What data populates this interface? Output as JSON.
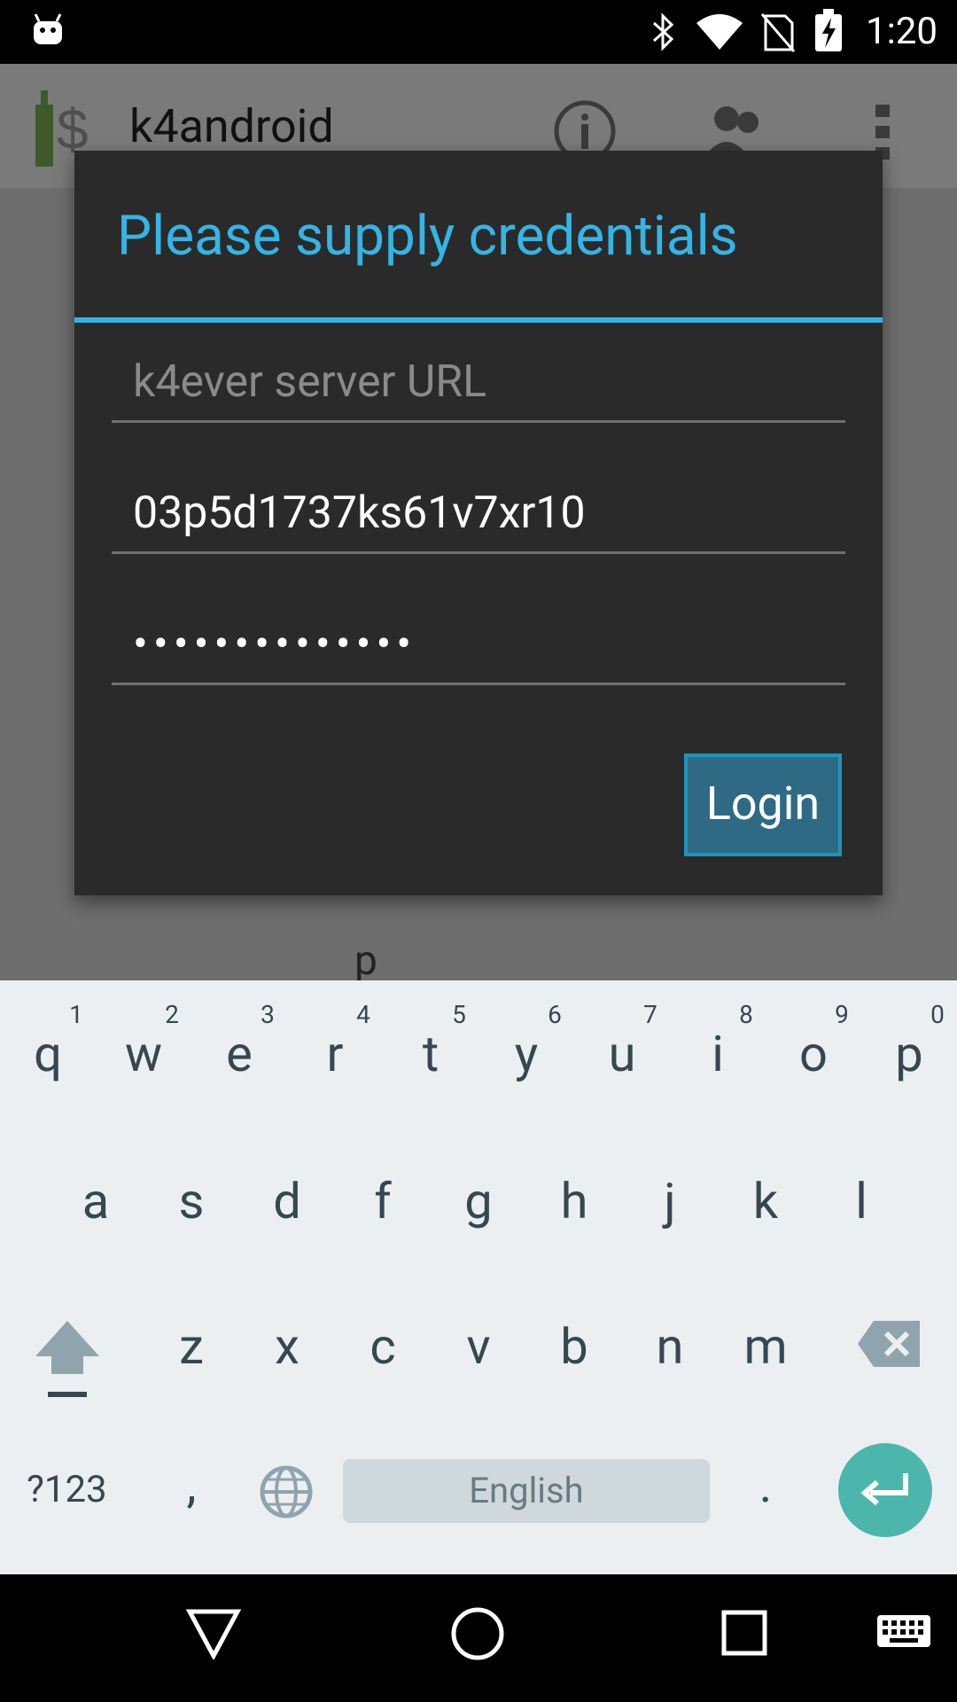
{
  "status_bar": {
    "time": "1:20"
  },
  "app": {
    "title": "k4android",
    "behind_text": "p"
  },
  "dialog": {
    "title": "Please supply credentials",
    "fields": [
      {
        "value": "",
        "placeholder": "k4ever server URL"
      },
      {
        "value": "03p5d1737ks61v7xr10",
        "placeholder": ""
      },
      {
        "value": "••••••••••••••",
        "placeholder": ""
      }
    ],
    "login_label": "Login"
  },
  "keyboard": {
    "row1": [
      "q",
      "w",
      "e",
      "r",
      "t",
      "y",
      "u",
      "i",
      "o",
      "p"
    ],
    "row1_hints": [
      "1",
      "2",
      "3",
      "4",
      "5",
      "6",
      "7",
      "8",
      "9",
      "0"
    ],
    "row2": [
      "a",
      "s",
      "d",
      "f",
      "g",
      "h",
      "j",
      "k",
      "l"
    ],
    "row3": [
      "z",
      "x",
      "c",
      "v",
      "b",
      "n",
      "m"
    ],
    "symbols_label": "?123",
    "comma": ",",
    "period": ".",
    "space_label": "English"
  },
  "colors": {
    "accent": "#33b5e5",
    "enter": "#4db6ac"
  }
}
